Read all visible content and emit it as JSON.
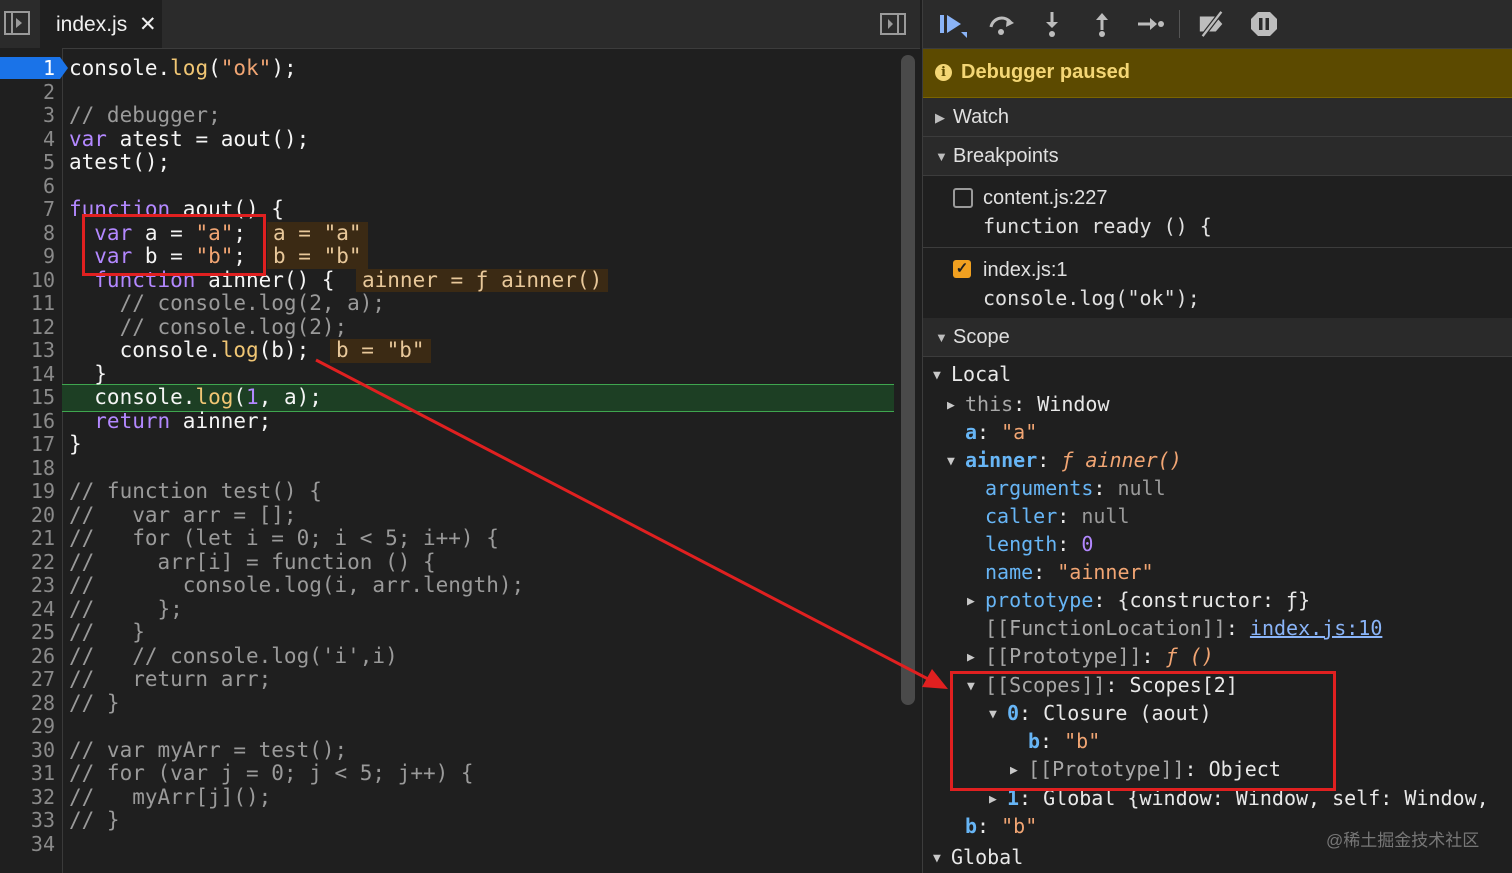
{
  "editor": {
    "tab": {
      "label": "index.js",
      "close": "✕"
    },
    "line_numbers": [
      "1",
      "2",
      "3",
      "4",
      "5",
      "6",
      "7",
      "8",
      "9",
      "10",
      "11",
      "12",
      "13",
      "14",
      "15",
      "16",
      "17",
      "18",
      "19",
      "20",
      "21",
      "22",
      "23",
      "24",
      "25",
      "26",
      "27",
      "28",
      "29",
      "30",
      "31",
      "32",
      "33",
      "34"
    ],
    "lines": {
      "l1a": "console.",
      "l1b": "log",
      "l1c": "(",
      "l1d": "\"ok\"",
      "l1e": ");",
      "l3": "// debugger;",
      "l4a": "var",
      "l4b": " atest = aout();",
      "l5": "atest();",
      "l7a": "function",
      "l7b": " aout() {",
      "l8a": "  var",
      "l8b": " a = ",
      "l8c": "\"a\"",
      "l8d": ";",
      "l9a": "  var",
      "l9b": " b = ",
      "l9c": "\"b\"",
      "l9d": ";",
      "l10a": "  function",
      "l10b": " ainner() {",
      "l11": "    // console.log(2, a);",
      "l12": "    // console.log(2);",
      "l13a": "    console.",
      "l13b": "log",
      "l13c": "(b);",
      "l14": "  }",
      "l15a": "  console.",
      "l15b": "log",
      "l15c": "(",
      "l15d": "1",
      "l15e": ", a);",
      "l16a": "  return",
      "l16b": " ainner;",
      "l17": "}",
      "l19": "// function test() {",
      "l20": "//   var arr = [];",
      "l21": "//   for (let i = 0; i < 5; i++) {",
      "l22": "//     arr[i] = function () {",
      "l23": "//       console.log(i, arr.length);",
      "l24": "//     };",
      "l25": "//   }",
      "l26": "//   // console.log('i',i)",
      "l27": "//   return arr;",
      "l28": "// }",
      "l30": "// var myArr = test();",
      "l31": "// for (var j = 0; j < 5; j++) {",
      "l32": "//   myArr[j]();",
      "l33": "// }"
    },
    "inline_values": {
      "v8": "a = \"a\"",
      "v9": "b = \"b\"",
      "v10": "ainner = ƒ ainner()",
      "v13": "b = \"b\""
    }
  },
  "sidebar": {
    "paused": "Debugger paused",
    "info_glyph": "i",
    "sections": {
      "watch": "Watch",
      "breakpoints": "Breakpoints",
      "scope": "Scope"
    },
    "breakpoints": [
      {
        "location": "content.js:227",
        "code": "function ready () {",
        "checked": false
      },
      {
        "location": "index.js:1",
        "code": "console.log(\"ok\");",
        "checked": true
      }
    ],
    "check_glyph": "✓",
    "scope": {
      "local": "Local",
      "this_key": "this",
      "this_val": "Window",
      "a_key": "a",
      "a_val": "\"a\"",
      "ainner_key": "ainner",
      "ainner_val": "ƒ ainner()",
      "arguments_key": "arguments",
      "arguments_val": "null",
      "caller_key": "caller",
      "caller_val": "null",
      "length_key": "length",
      "length_val": "0",
      "name_key": "name",
      "name_val": "\"ainner\"",
      "prototype_key": "prototype",
      "prototype_val": "{constructor: ƒ}",
      "fnloc_key": "[[FunctionLocation]]",
      "fnloc_val": "index.js:10",
      "proto_key": "[[Prototype]]",
      "proto_val": "ƒ ()",
      "scopes_key": "[[Scopes]]",
      "scopes_val": "Scopes[2]",
      "s0_key": "0",
      "s0_val": "Closure (aout)",
      "s0b_key": "b",
      "s0b_val": "\"b\"",
      "s0proto_key": "[[Prototype]]",
      "s0proto_val": "Object",
      "s1_key": "1",
      "s1_val": "Global {window: Window, self: Window,",
      "b_key": "b",
      "b_val": "\"b\"",
      "global": "Global"
    },
    "watermark": "@稀土掘金技术社区"
  },
  "colors": {
    "accent_blue": "#1a73e8",
    "exec_line": "#1d3f24",
    "paused_bg": "#5c4a00",
    "annotation_red": "#e02020"
  }
}
